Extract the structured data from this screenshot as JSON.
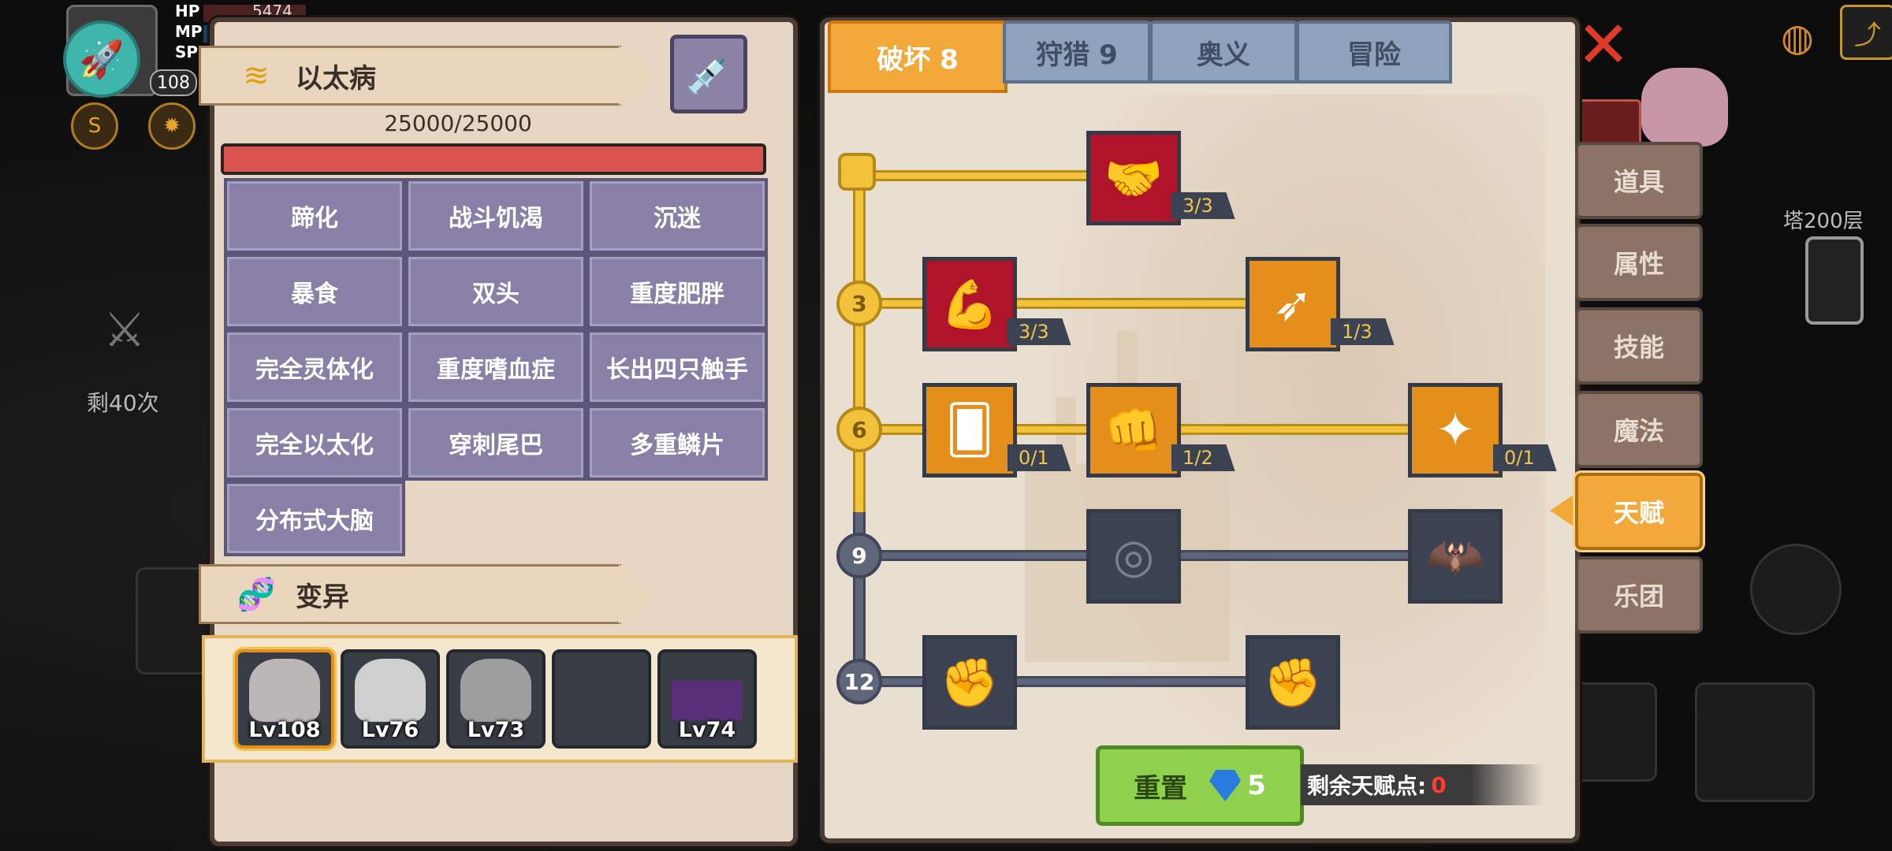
{
  "hud": {
    "hp_label": "HP",
    "mp_label": "MP",
    "sp_label": "SP",
    "hp_value": "5474",
    "player_level": "108",
    "remaining_count": "剩40次",
    "tower_floor": "塔200层"
  },
  "disease_panel": {
    "title": "以太病",
    "hp_text": "25000/25000",
    "traits": [
      "蹄化",
      "战斗饥渴",
      "沉迷",
      "暴食",
      "双头",
      "重度肥胖",
      "完全灵体化",
      "重度嗜血症",
      "长出四只触手",
      "完全以太化",
      "穿刺尾巴",
      "多重鳞片",
      "分布式大脑"
    ]
  },
  "mutation_panel": {
    "title": "变异",
    "slots": [
      {
        "level": "Lv108",
        "selected": true
      },
      {
        "level": "Lv76",
        "selected": false
      },
      {
        "level": "Lv73",
        "selected": false
      },
      {
        "level": "",
        "selected": false
      },
      {
        "level": "Lv74",
        "selected": false
      }
    ]
  },
  "talent_tabs": [
    {
      "label": "破坏 8",
      "active": true
    },
    {
      "label": "狩猎 9",
      "active": false
    },
    {
      "label": "奥义",
      "active": false
    },
    {
      "label": "冒险",
      "active": false
    }
  ],
  "talent_tree": {
    "tiers": [
      "",
      "3",
      "6",
      "9",
      "12"
    ],
    "skills": [
      {
        "name": "arm-wrestle-skill",
        "glyph": "🤝",
        "progress": "3/3",
        "state": "red"
      },
      {
        "name": "muscle-body-skill",
        "glyph": "💪",
        "progress": "3/3",
        "state": "red"
      },
      {
        "name": "piercing-arrow-skill",
        "glyph": "➶",
        "progress": "1/3",
        "state": "gold"
      },
      {
        "name": "card-slash-skill",
        "glyph": "🂠",
        "progress": "0/1",
        "state": "gold"
      },
      {
        "name": "punch-skill",
        "glyph": "👊",
        "progress": "1/2",
        "state": "gold"
      },
      {
        "name": "splash-strike-skill",
        "glyph": "✦",
        "progress": "0/1",
        "state": "gold"
      },
      {
        "name": "ripple-skill",
        "glyph": "◎",
        "progress": "",
        "state": "gray"
      },
      {
        "name": "bat-wing-skill",
        "glyph": "🦇",
        "progress": "",
        "state": "gray"
      },
      {
        "name": "fist-skill",
        "glyph": "✊",
        "progress": "",
        "state": "gray"
      },
      {
        "name": "side-fist-skill",
        "glyph": "✊",
        "progress": "",
        "state": "gray"
      }
    ]
  },
  "reset": {
    "label": "重置",
    "cost": "5"
  },
  "points": {
    "label": "剩余天赋点:",
    "value": "0"
  },
  "side_menu": [
    {
      "label": "道具",
      "active": false
    },
    {
      "label": "属性",
      "active": false
    },
    {
      "label": "技能",
      "active": false
    },
    {
      "label": "魔法",
      "active": false
    },
    {
      "label": "天赋",
      "active": true
    },
    {
      "label": "乐团",
      "active": false
    }
  ],
  "colors": {
    "active_tab": "#f3a93a",
    "inactive_tab": "#8ea2bd",
    "talent_line_on": "#f2c23b",
    "talent_line_off": "#60667a",
    "points_value": "#ff3b2f",
    "reset_button": "#8fd14f"
  }
}
